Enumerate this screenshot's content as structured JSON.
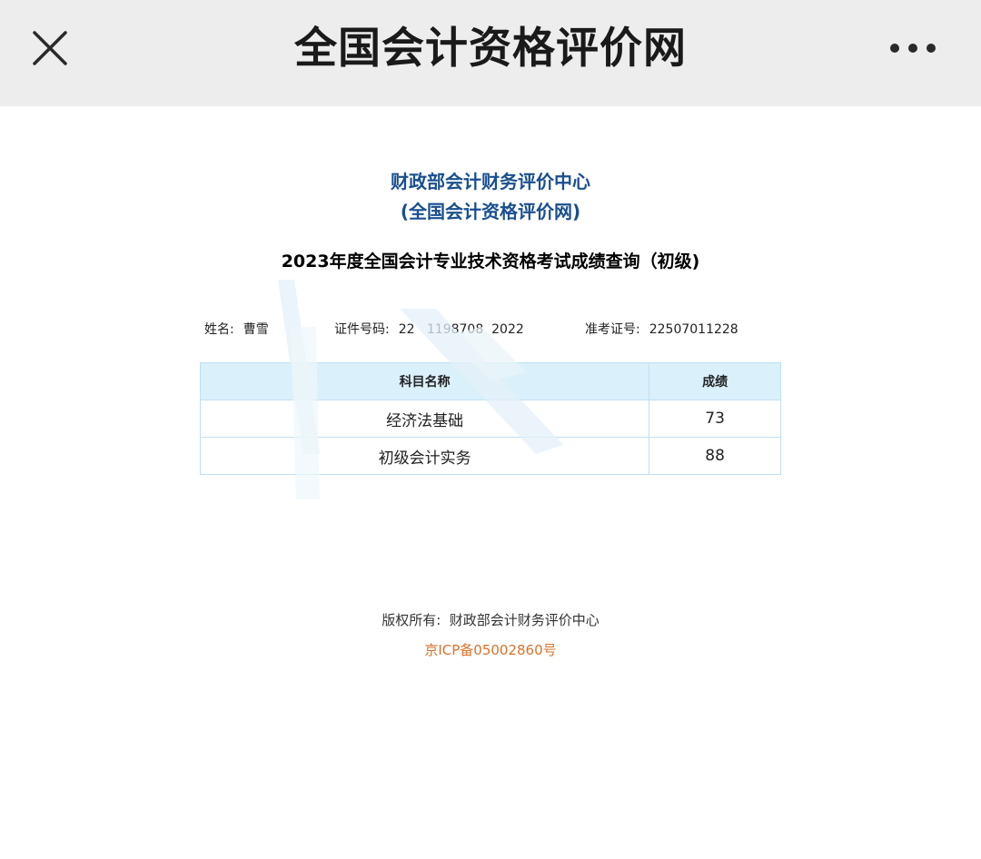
{
  "topbar": {
    "title": "全国会计资格评价网",
    "close_icon": "close-icon",
    "more_icon": "more-dots-icon"
  },
  "header": {
    "org_line1": "财政部会计财务评价中心",
    "org_line2": "(全国会计资格评价网)",
    "heading": "2023年度全国会计专业技术资格考试成绩查询（初级)"
  },
  "info": {
    "name_label": "姓名:",
    "name_value": "曹雪",
    "id_label": "证件号码:",
    "id_value": "22   1198708  2022",
    "exam_label": "准考证号:",
    "exam_value": "22507011228"
  },
  "table": {
    "headers": [
      "科目名称",
      "成绩"
    ],
    "rows": [
      {
        "subject": "经济法基础",
        "score": "73"
      },
      {
        "subject": "初级会计实务",
        "score": "88"
      }
    ]
  },
  "footer": {
    "copyright": "版权所有:  财政部会计财务评价中心",
    "icp": "京ICP备05002860号"
  },
  "colors": {
    "topbar_bg": "#ededed",
    "org_blue": "#1a4f8f",
    "icp_orange": "#d8722b",
    "table_header_bg": "#daf0fb",
    "table_border": "#bfe0f2"
  }
}
